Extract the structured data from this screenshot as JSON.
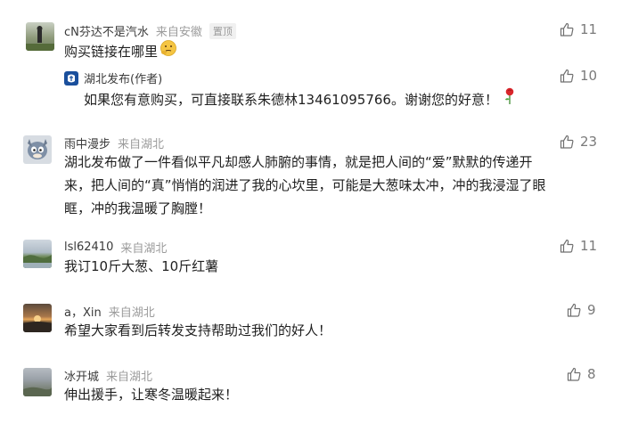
{
  "comments": [
    {
      "name": "cN芬达不是汽水",
      "location": "来自安徽",
      "badge": "置顶",
      "text": "购买链接在哪里",
      "likes": "11",
      "emoji": "thinking-emoji",
      "reply": {
        "author": "湖北发布(作者)",
        "text": "如果您有意购买，可直接联系朱德林13461095766。谢谢您的好意！",
        "likes": "10",
        "emoji": "rose-emoji"
      }
    },
    {
      "name": "雨中漫步",
      "location": "来自湖北",
      "lines": [
        "湖北发布做了一件看似平凡却感人肺腑的事情，就是把人间的“爱”默默的传递开",
        "来，把人间的“真”悄悄的润进了我的心坎里，可能是大葱味太冲，冲的我浸湿了眼",
        "眶，冲的我温暖了胸膛！"
      ],
      "likes": "23"
    },
    {
      "name": "lsl62410",
      "location": "来自湖北",
      "text": "我订10斤大葱、10斤红薯",
      "likes": "11"
    },
    {
      "name": "a，Xin",
      "location": "来自湖北",
      "text": "希望大家看到后转发支持帮助过我们的好人！",
      "likes": "9"
    },
    {
      "name": "冰开城",
      "location": "来自湖北",
      "text": "伸出援手，让寒冬温暖起来！",
      "likes": "8"
    }
  ],
  "colors": {
    "text": "#1f1f1f",
    "muted": "#9b9b9b",
    "like_icon": "#7a7a7a",
    "author_brand": "#1a4f9c"
  }
}
